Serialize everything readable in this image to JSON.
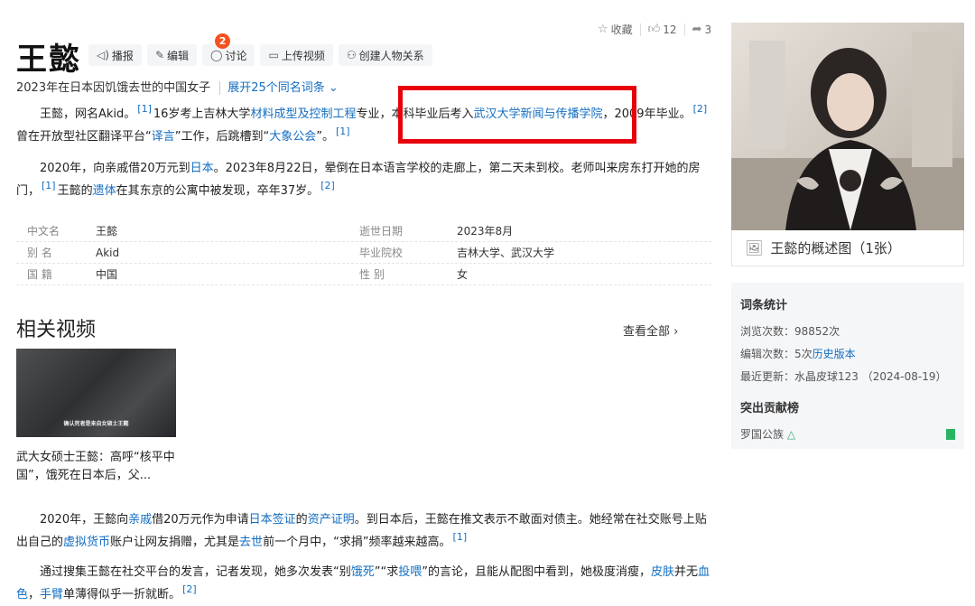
{
  "top_actions": {
    "collect": "收藏",
    "like_count": "12",
    "share_count": "3"
  },
  "title": "王懿",
  "toolbar": {
    "broadcast": "播报",
    "edit": "编辑",
    "discuss": "讨论",
    "discuss_badge": "2",
    "upload_video": "上传视频",
    "create_relation": "创建人物关系"
  },
  "subtitle": {
    "text": "2023年在日本因饥饿去世的中国女子",
    "expand": "展开25个同名词条"
  },
  "para1": {
    "a": "王懿，网名Akid。",
    "ref1": "[1]",
    "b": "16岁考上吉林大学",
    "link1": "材料成型及控制工程",
    "c": "专业，本科毕业后考入",
    "link2": "武汉大学新闻与传播学院",
    "d": "，2009年毕业。",
    "ref2": "[2]",
    "e": "曾在开放型社区翻译平台“",
    "link3": "译言",
    "f": "”工作，后跳槽到“",
    "link4": "大象公会",
    "g": "”。",
    "ref3": "[1]"
  },
  "para2": {
    "a": "2020年，向亲戚借20万元到",
    "link1": "日本",
    "b": "。2023年8月22日，晕倒在日本语言学校的走廊上，第二天未到校。老师叫来房东打开她的房门，",
    "ref1": "[1]",
    "c": "王懿的",
    "link2": "遗体",
    "d": "在其东京的公寓中被发现，卒年37岁。",
    "ref2": "[2]"
  },
  "info": {
    "rows": [
      {
        "k1": "中文名",
        "v1": "王懿",
        "k2": "逝世日期",
        "v2": "2023年8月"
      },
      {
        "k1": "别 名",
        "v1": "Akid",
        "k2": "毕业院校",
        "v2": "吉林大学、武汉大学"
      },
      {
        "k1": "国 籍",
        "v1": "中国",
        "k2": "性 别",
        "v2": "女"
      }
    ]
  },
  "related_videos": {
    "title": "相关视频",
    "see_all": "查看全部",
    "video": {
      "caption": "确认死者是来自女硕士王懿",
      "title": "武大女硕士王懿：高呼“核平中国”，饿死在日本后，父..."
    }
  },
  "para3": {
    "a": "2020年，王懿向",
    "link1": "亲戚",
    "b": "借20万元作为申请",
    "link2": "日本签证",
    "c": "的",
    "link3": "资产证明",
    "d": "。到日本后，王懿在推文表示不敢面对债主。她经常在社交账号上贴出自己的",
    "link4": "虚拟货币",
    "e": "账户让网友捐赠，尤其是",
    "link5": "去世",
    "f": "前一个月中，“求捐”频率越来越高。",
    "ref1": "[1]"
  },
  "para4": {
    "a": "通过搜集王懿在社交平台的发言，记者发现，她多次发表“别",
    "link1": "饿死",
    "b": "”“求",
    "link2": "投喂",
    "c": "”的言论，且能从配图中看到，她极度消瘦，",
    "link3": "皮肤",
    "d": "并无",
    "link4": "血色",
    "e": "，",
    "link5": "手臂",
    "f": "单薄得似乎一折就断。",
    "ref1": "[2]"
  },
  "sidebar": {
    "photo_caption": "王懿的概述图（1张）",
    "stats": {
      "title": "词条统计",
      "views": "浏览次数：98852次",
      "edits_prefix": "编辑次数：5次",
      "history_link": "历史版本",
      "last_update": "最近更新：水晶皮球123 （2024-08-19）",
      "contrib_title": "突出贡献榜",
      "contributor": "罗国公族"
    }
  },
  "colors": {
    "link": "#136ec2",
    "highlight": "#e8000b",
    "badge": "#f4511e"
  }
}
